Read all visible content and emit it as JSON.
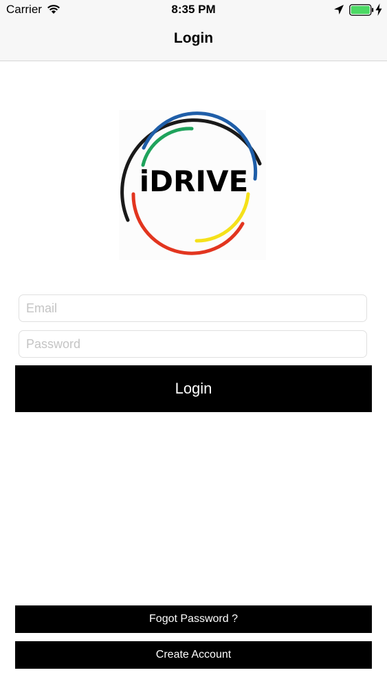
{
  "status_bar": {
    "carrier": "Carrier",
    "time": "8:35 PM",
    "battery_color": "#4cd964"
  },
  "nav": {
    "title": "Login"
  },
  "logo": {
    "text": "iDRIVE",
    "ring_colors": {
      "outer": "#1a1a1a",
      "blue": "#1f5ea8",
      "green": "#1fa35c",
      "yellow": "#f5e11a",
      "red": "#e2351f"
    }
  },
  "form": {
    "email_placeholder": "Email",
    "email_value": "",
    "password_placeholder": "Password",
    "password_value": "",
    "login_label": "Login"
  },
  "footer": {
    "forgot_label": "Fogot Password ?",
    "create_label": "Create Account"
  }
}
